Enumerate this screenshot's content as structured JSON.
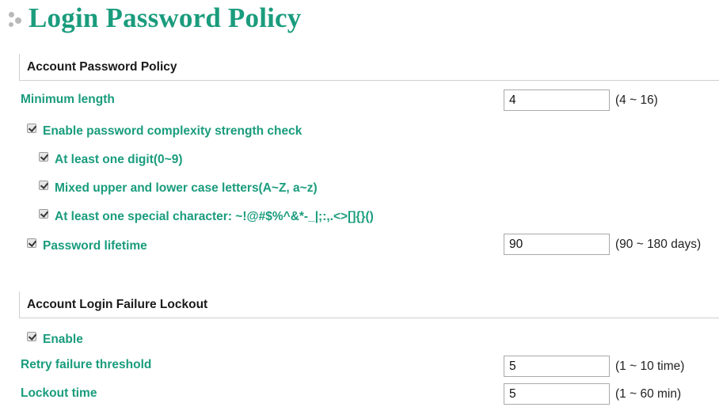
{
  "page": {
    "title": "Login Password Policy"
  },
  "account_password_policy": {
    "heading": "Account Password Policy",
    "minimum_length": {
      "label": "Minimum length",
      "value": "4",
      "range": "(4 ~ 16)"
    },
    "complexity_check": {
      "label": "Enable password complexity strength check",
      "checked": true
    },
    "digit_rule": {
      "label": "At least one digit(0~9)",
      "checked": true
    },
    "case_rule": {
      "label": "Mixed upper and lower case letters(A~Z, a~z)",
      "checked": true
    },
    "special_rule": {
      "label": "At least one special character: ~!@#$%^&*-_|;:,.<>[]{}()",
      "checked": true
    },
    "lifetime": {
      "label": "Password lifetime",
      "checked": true,
      "value": "90",
      "range": "(90 ~ 180 days)"
    }
  },
  "lockout": {
    "heading": "Account Login Failure Lockout",
    "enable": {
      "label": "Enable",
      "checked": true
    },
    "retry_threshold": {
      "label": "Retry failure threshold",
      "value": "5",
      "range": "(1 ~ 10 time)"
    },
    "lockout_time": {
      "label": "Lockout time",
      "value": "5",
      "range": "(1 ~ 60 min)"
    }
  },
  "colors": {
    "accent": "#1a9c7d",
    "heading_text": "#1a1a1a",
    "divider": "#cfcfcf"
  }
}
